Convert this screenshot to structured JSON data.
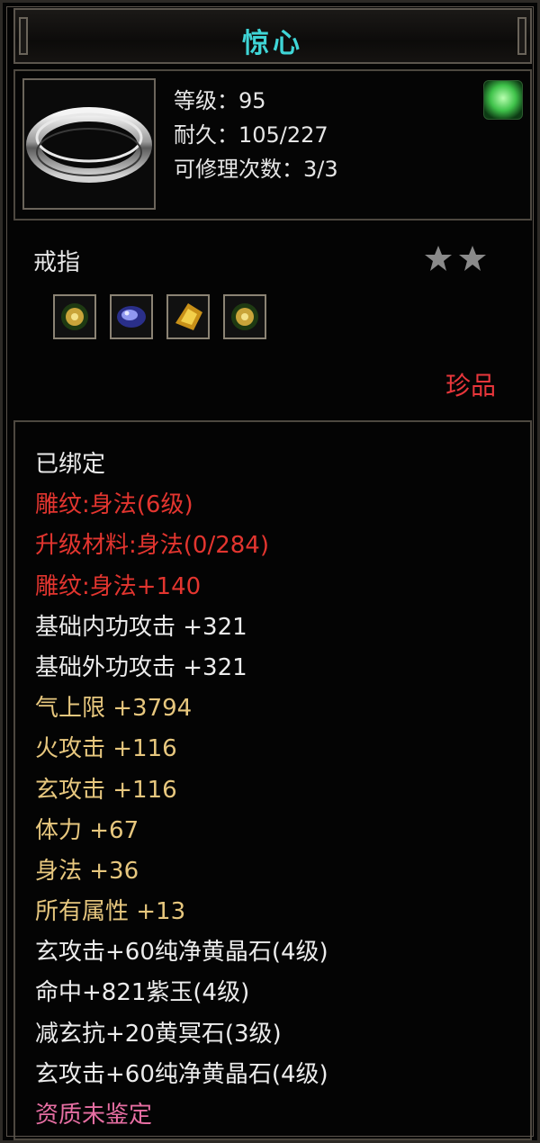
{
  "item": {
    "name": "惊心",
    "stats": {
      "level": "等级：95",
      "durability": "耐久：105/227",
      "repair": "可修理次数：3/3"
    },
    "type": "戒指",
    "stars": 2,
    "rarity": "珍品",
    "sockets": [
      "yellow-gem-icon",
      "purple-gem-icon",
      "gold-gem-icon",
      "yellow-gem-icon"
    ]
  },
  "attributes": [
    {
      "text": "已绑定",
      "color": "white"
    },
    {
      "text": "雕纹:身法(6级)",
      "color": "red"
    },
    {
      "text": "升级材料:身法(0/284)",
      "color": "red"
    },
    {
      "text": "雕纹:身法+140",
      "color": "red"
    },
    {
      "text": "基础内功攻击  +321",
      "color": "white"
    },
    {
      "text": "基础外功攻击  +321",
      "color": "white"
    },
    {
      "text": "气上限  +3794",
      "color": "gold"
    },
    {
      "text": "火攻击  +116",
      "color": "gold"
    },
    {
      "text": "玄攻击  +116",
      "color": "gold"
    },
    {
      "text": "体力  +67",
      "color": "gold"
    },
    {
      "text": "身法  +36",
      "color": "gold"
    },
    {
      "text": "所有属性  +13",
      "color": "gold"
    },
    {
      "text": "玄攻击+60纯净黄晶石(4级)",
      "color": "white"
    },
    {
      "text": "命中+821紫玉(4级)",
      "color": "white"
    },
    {
      "text": "减玄抗+20黄冥石(3级)",
      "color": "white"
    },
    {
      "text": "玄攻击+60纯净黄晶石(4级)",
      "color": "white"
    },
    {
      "text": "资质未鉴定",
      "color": "pink"
    }
  ],
  "colors": {
    "title": "#3fd5d6",
    "red": "#e3352f",
    "gold": "#e7c77e",
    "white": "#ececec",
    "pink": "#e66ea2",
    "rarity": "#e8363b"
  }
}
